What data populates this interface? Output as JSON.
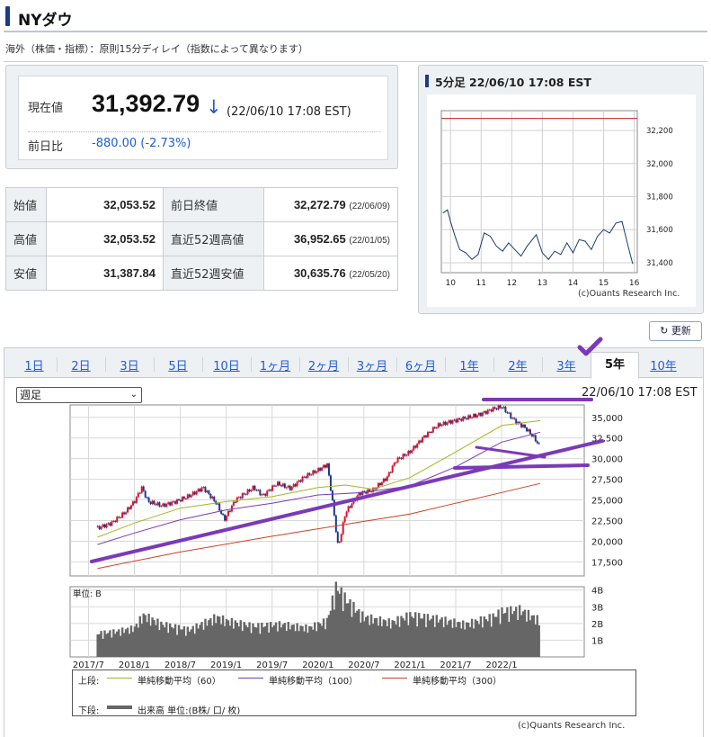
{
  "title": "NYダウ",
  "notice": "海外（株価・指標）：原則15分ディレイ（指数によって異なります）",
  "quote": {
    "current_label": "現在値",
    "current_value": "31,392.79",
    "arrow": "↓",
    "timestamp": "(22/06/10 17:08 EST)",
    "change_label": "前日比",
    "change_value": "-880.00 (-2.73%)"
  },
  "stats": [
    {
      "label": "始値",
      "value": "32,053.52",
      "label2": "前日終値",
      "value2": "32,272.79",
      "date2": "(22/06/09)"
    },
    {
      "label": "高値",
      "value": "32,053.52",
      "label2": "直近52週高値",
      "value2": "36,952.65",
      "date2": "(22/01/05)"
    },
    {
      "label": "安値",
      "value": "31,387.84",
      "label2": "直近52週安値",
      "value2": "30,635.76",
      "date2": "(22/05/20)"
    }
  ],
  "mini": {
    "title": "5分足 22/06/10 17:08 EST",
    "copyright": "(c)Ouants Research Inc."
  },
  "refresh_label": "更新",
  "tabs": [
    "1日",
    "2日",
    "3日",
    "5日",
    "10日",
    "1ヶ月",
    "2ヶ月",
    "3ヶ月",
    "6ヶ月",
    "1年",
    "2年",
    "3年",
    "5年",
    "10年"
  ],
  "active_tab": "5年",
  "period_select": "週足",
  "main_stamp": "22/06/10 17:08 EST",
  "volume_unit": "単位: B",
  "legend": {
    "upper_label": "上段:",
    "ma60": "単純移動平均（60）",
    "ma100": "単純移動平均（100）",
    "ma300": "単純移動平均（300）",
    "lower_label": "下段:",
    "volume": "出来高 単位:(B株/ 口/ 枚)"
  },
  "main_copyright": "(c)Quants Research Inc.",
  "colors": {
    "up": "#e0102a",
    "down": "#1a3a8a",
    "ma60": "#a0b820",
    "ma100": "#7a3ab8",
    "ma300": "#d04020",
    "annot": "#7a3ab8",
    "link": "#1f5bd6"
  },
  "chart_data": [
    {
      "type": "line",
      "title": "5分足 22/06/10 17:08 EST",
      "x_ticks": [
        "10",
        "11",
        "12",
        "13",
        "14",
        "15",
        "16"
      ],
      "y_ticks": [
        "32,200",
        "32,000",
        "31,800",
        "31,600",
        "31,400"
      ],
      "ylim": [
        31340,
        32320
      ],
      "reference_line": 32272.79,
      "x": [
        9.75,
        9.9,
        10.0,
        10.15,
        10.3,
        10.5,
        10.7,
        10.9,
        11.1,
        11.3,
        11.5,
        11.7,
        11.9,
        12.1,
        12.3,
        12.5,
        12.8,
        13.0,
        13.2,
        13.4,
        13.6,
        13.8,
        14.0,
        14.2,
        14.4,
        14.6,
        14.8,
        15.0,
        15.2,
        15.4,
        15.6,
        15.8,
        15.95
      ],
      "values": [
        31700,
        31720,
        31650,
        31560,
        31480,
        31460,
        31420,
        31450,
        31580,
        31560,
        31500,
        31470,
        31520,
        31480,
        31440,
        31500,
        31570,
        31460,
        31420,
        31470,
        31450,
        31520,
        31460,
        31540,
        31530,
        31480,
        31560,
        31600,
        31580,
        31640,
        31650,
        31500,
        31393
      ]
    },
    {
      "type": "line",
      "title": "週足",
      "x_ticks": [
        "2017/7",
        "2018/1",
        "2018/7",
        "2019/1",
        "2019/7",
        "2020/1",
        "2020/7",
        "2021/1",
        "2021/7",
        "2022/1"
      ],
      "y_ticks": [
        "35,000",
        "32,500",
        "30,000",
        "27,500",
        "25,000",
        "22,500",
        "20,000",
        "17,500"
      ],
      "ylim": [
        15800,
        36500
      ],
      "series": [
        {
          "name": "",
          "x": [
            2017.6,
            2017.75,
            2017.9,
            2018.0,
            2018.08,
            2018.15,
            2018.3,
            2018.45,
            2018.6,
            2018.75,
            2018.9,
            2018.98,
            2019.1,
            2019.3,
            2019.4,
            2019.55,
            2019.7,
            2019.85,
            2020.0,
            2020.1,
            2020.15,
            2020.22,
            2020.3,
            2020.45,
            2020.6,
            2020.75,
            2020.85,
            2021.0,
            2021.15,
            2021.3,
            2021.45,
            2021.6,
            2021.75,
            2021.9,
            2022.0,
            2022.15,
            2022.25,
            2022.35,
            2022.42
          ],
          "values": [
            21600,
            22200,
            23500,
            24800,
            26500,
            24800,
            24300,
            24800,
            25500,
            26500,
            24500,
            22600,
            25000,
            26500,
            25500,
            27000,
            26400,
            27800,
            28600,
            29300,
            25500,
            19200,
            23500,
            25800,
            26200,
            27700,
            29800,
            30800,
            32600,
            34000,
            34500,
            34900,
            35300,
            36000,
            36300,
            34500,
            33800,
            32600,
            31393
          ]
        },
        {
          "name": "単純移動平均（60）",
          "x": [
            2017.6,
            2018.0,
            2018.5,
            2019.0,
            2019.5,
            2020.0,
            2020.3,
            2020.6,
            2021.0,
            2021.5,
            2022.0,
            2022.42
          ],
          "values": [
            20500,
            22200,
            24000,
            24800,
            25400,
            26500,
            26800,
            26300,
            27700,
            30800,
            34000,
            34600
          ]
        },
        {
          "name": "単純移動平均（100）",
          "x": [
            2017.6,
            2018.0,
            2018.5,
            2019.0,
            2019.5,
            2020.0,
            2020.5,
            2021.0,
            2021.5,
            2022.0,
            2022.42
          ],
          "values": [
            19600,
            21000,
            22600,
            23800,
            24600,
            25600,
            25900,
            26700,
            29000,
            32000,
            33200
          ]
        },
        {
          "name": "単純移動平均（300）",
          "x": [
            2017.6,
            2018.5,
            2019.5,
            2020.5,
            2021.0,
            2021.5,
            2022.0,
            2022.42
          ],
          "values": [
            16700,
            18700,
            20600,
            22400,
            23300,
            24600,
            25900,
            27000
          ]
        }
      ]
    },
    {
      "type": "bar",
      "title": "出来高",
      "y_ticks": [
        "4B",
        "3B",
        "2B",
        "1B"
      ],
      "ylim": [
        0,
        4.2
      ],
      "x": [
        2017.6,
        2017.8,
        2018.0,
        2018.1,
        2018.3,
        2018.6,
        2018.9,
        2019.0,
        2019.3,
        2019.6,
        2019.9,
        2020.1,
        2020.2,
        2020.3,
        2020.5,
        2020.8,
        2021.0,
        2021.3,
        2021.6,
        2021.9,
        2022.0,
        2022.2,
        2022.42
      ],
      "values": [
        1.3,
        1.4,
        1.6,
        2.3,
        1.8,
        1.5,
        2.2,
        2.0,
        1.7,
        1.8,
        1.6,
        2.0,
        3.9,
        3.2,
        2.2,
        1.9,
        2.3,
        2.1,
        1.8,
        2.2,
        2.5,
        2.6,
        2.0
      ]
    }
  ]
}
